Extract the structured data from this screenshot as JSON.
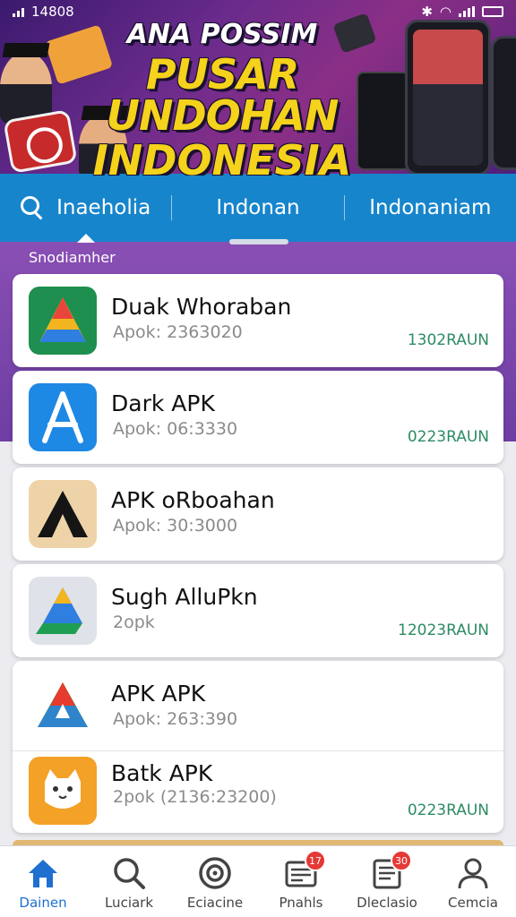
{
  "status_bar": {
    "time": "14808"
  },
  "banner": {
    "line1": "ANA POSSIM",
    "line2": "PUSAR UNDOHAN",
    "line3": "INDONESIA"
  },
  "tabs": [
    {
      "label": "Inaeholia",
      "icon": "search-icon",
      "active": true
    },
    {
      "label": "Indonan",
      "active": false
    },
    {
      "label": "Indonaniam",
      "active": false
    }
  ],
  "section_label": "Snodiamher",
  "apps": [
    {
      "name": "Duak Whoraban",
      "sub": "Apok: 2363020",
      "meta": "1302RAUN",
      "icon": "green-triangle-app-icon"
    },
    {
      "name": "Dark APK",
      "sub": "Apok: 06:3330",
      "meta": "0223RAUN",
      "icon": "blue-a-app-icon"
    },
    {
      "name": "APK oRboahan",
      "sub": "Apok: 30:3000",
      "meta": "",
      "icon": "black-a-app-icon"
    },
    {
      "name": "Sugh AlluPkn",
      "sub": "2opk",
      "meta": "12023RAUN",
      "icon": "drive-app-icon"
    },
    {
      "name": "APK APK",
      "sub": "Apok: 263:390",
      "meta": "",
      "icon": "tricolor-app-icon"
    },
    {
      "name": "Batk APK",
      "sub": "2pok (2136:23200)",
      "meta": "0223RAUN",
      "icon": "cat-app-icon"
    }
  ],
  "bottom_nav": [
    {
      "label": "Dainen",
      "icon": "home-icon",
      "active": true,
      "badge": ""
    },
    {
      "label": "Luciark",
      "icon": "search-icon",
      "active": false,
      "badge": ""
    },
    {
      "label": "Eciacine",
      "icon": "target-icon",
      "active": false,
      "badge": ""
    },
    {
      "label": "Pnahls",
      "icon": "mail-icon",
      "active": false,
      "badge": "17"
    },
    {
      "label": "Dleclasio",
      "icon": "document-icon",
      "active": false,
      "badge": "30"
    },
    {
      "label": "Cemcia",
      "icon": "profile-icon",
      "active": false,
      "badge": ""
    }
  ],
  "colors": {
    "tab_bar": "#1785cc",
    "banner_title": "#f5d21b",
    "meta_text": "#2c8b63",
    "nav_active": "#1e6fcf",
    "badge": "#e53935"
  }
}
